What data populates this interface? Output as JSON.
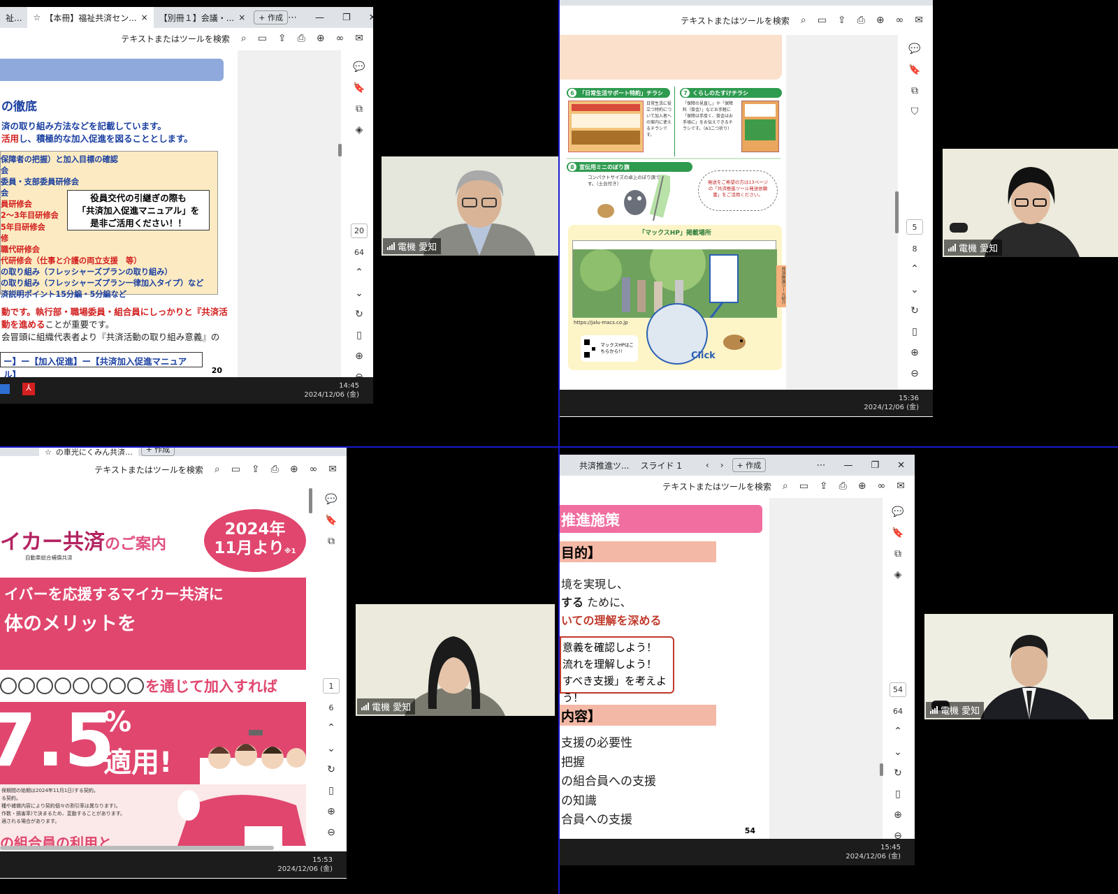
{
  "colors": {
    "divider": "#1a1acc",
    "accent_red": "#d21e1e",
    "accent_blue": "#1a3fa0",
    "pink": "#e05080",
    "taskbar": "#1c1c1c"
  },
  "q1": {
    "tabs": [
      "祉...",
      "【本冊】福祉共済セン...",
      "【別冊１】会議・..."
    ],
    "new_tab": "+ 作成",
    "search": "テキストまたはツールを検索",
    "heading": "の徹底",
    "intro_1": "済の取り組み方法などを記載しています。",
    "intro_2_red": "活用",
    "intro_2": "し、積極的な加入促進を図ることとします。",
    "box_lines": [
      {
        "text": "保障者の把握）と加入目標の確認",
        "color": "blue"
      },
      {
        "text": "会",
        "color": "blue"
      },
      {
        "text": "委員・支部委員研修会",
        "color": "blue"
      },
      {
        "text": "会",
        "color": "blue"
      },
      {
        "text": "員研修会",
        "color": "red"
      },
      {
        "text": "2～3年目研修会",
        "color": "red"
      },
      {
        "text": "5年目研修会",
        "color": "red"
      },
      {
        "text": "修",
        "color": "red"
      },
      {
        "text": "職代研修会",
        "color": "red"
      },
      {
        "text": "代研修会（仕事と介護の両立支援　等）",
        "color": "red"
      },
      {
        "text": "の取り組み（フレッシャーズプランの取り組み）",
        "color": "blue"
      },
      {
        "text": "の取り組み（フレッシャーズプラン一律加入タイプ）など",
        "color": "blue"
      },
      {
        "text": "済説明ポイント15分編・5分編など",
        "color": "blue"
      }
    ],
    "callout": [
      "役員交代の引継ぎの際も",
      "「共済加入促進マニュアル」を",
      "是非ご活用ください！！"
    ],
    "para_1": "動です。執行部・職場委員・組合員にしっかりと『共済活",
    "para_2_red": "動を進める",
    "para_2": "ことが重要です。",
    "para_3": "会冒頭に組織代表者より『共済活動の取り組み意義』の",
    "link_box": "ー】ー【加入促進】ー【共済加入促進マニュアル】",
    "page_no": "20",
    "page_current": "20",
    "page_total": "64",
    "time": "14:45",
    "date": "2024/12/06 (金)",
    "participant": "電機 愛知"
  },
  "q2": {
    "search": "テキストまたはツールを検索",
    "item6_num": "6",
    "item6_title": "「日常生活サポート特約」チラシ",
    "item6_desc": "日常生活に役立つ特約について加入者への案内に使えるチラシです。",
    "item7_num": "7",
    "item7_title": "くらしのたすけチラシ",
    "item7_desc": "「保障の見直し」や「保障料（掛金）」などお手軽に「保障は手厚く、掛金はお手頃に」をお伝えできるチラシです。（A3二つ折り）",
    "item8_num": "8",
    "item8_title": "宣伝用ミニのぼり旗",
    "item8_desc": "コンパクトサイズの卓上のぼり旗です。（土台付き）",
    "bubble": "発送をご希望の方は13ページの「共済推進ツール発送依頼書」をご活用ください。",
    "hp_title": "「マックスHP」掲載場所",
    "url": "https://jalu-macs.co.jp",
    "qr_label": "マックスHPはこちらから!!",
    "click": "Click",
    "side_tab": "共済推進ツール紹介",
    "page_current": "5",
    "page_total": "8",
    "time": "15:36",
    "date": "2024/12/06 (金)",
    "participant": "電機 愛知"
  },
  "q3": {
    "tabs": [
      "の車光にくみん共済...",
      "+ 作成"
    ],
    "search": "テキストまたはツールを検索",
    "title_main": "イカー共済",
    "title_sub": "のご案内",
    "issuer": "自動車総合補償共済",
    "badge_1": "2024年",
    "badge_2": "11月より",
    "badge_note": "※1",
    "banner_1": "イバーを応援するマイカー共済に",
    "banner_2": "体のメリットを",
    "circles_text": "を通じて加入すれば",
    "big_number": "7.5",
    "percent": "%",
    "applied": "適用!",
    "fine_1": "保期間の始期は2024年11月1日)する契約。",
    "fine_2": "る契約。",
    "fine_3": "種や補償内容により契約個々の割引率は異なります)。",
    "fine_4": "作数・損害率)で決まるため、変動することがあります。",
    "fine_5": "適される場合があります。",
    "bottom_text": "の組合員の利用と",
    "page_current": "1",
    "page_total": "6",
    "time": "15:53",
    "date": "2024/12/06 (金)",
    "participant": "電機 愛知"
  },
  "q4": {
    "tabs": [
      "共済推進ツ...",
      "スライド 1"
    ],
    "new_tab": "+ 作成",
    "search": "テキストまたはツールを検索",
    "header": "推進施策",
    "section_1": "目的】",
    "line_1": "境を実現し、",
    "line_2_bold": "する",
    "line_2": " ために、",
    "line_3": "いての理解を深める",
    "box_lines": [
      "意義を確認しよう！",
      "流れを理解しよう！",
      "すべき支援」を考えよう！"
    ],
    "section_2": "内容】",
    "content_lines": [
      "支援の必要性",
      "把握",
      "の組合員への支援",
      "の知識",
      "合員への支援"
    ],
    "page_no": "54",
    "page_current": "54",
    "page_total": "64",
    "time": "15:45",
    "date": "2024/12/06 (金)",
    "participant": "電機 愛知"
  }
}
